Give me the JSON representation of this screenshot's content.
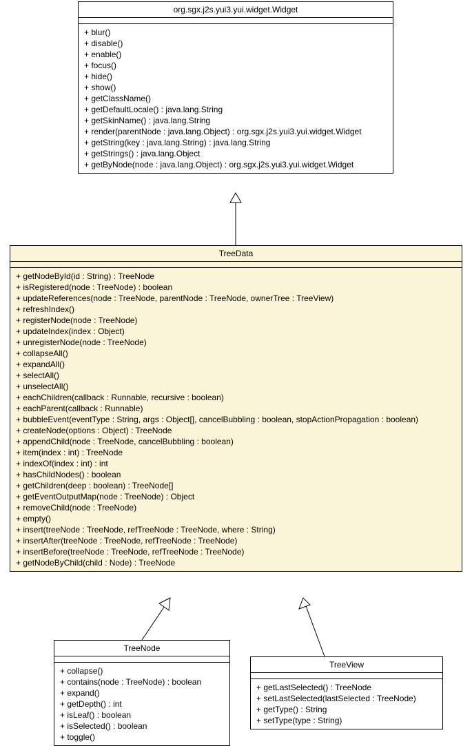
{
  "classes": {
    "widget": {
      "name": "org.sgx.j2s.yui3.yui.widget.Widget",
      "methods": [
        "+ blur()",
        "+ disable()",
        "+ enable()",
        "+ focus()",
        "+ hide()",
        "+ show()",
        "+ getClassName()",
        "+ getDefaultLocale() : java.lang.String",
        "+ getSkinName() : java.lang.String",
        "+ render(parentNode : java.lang.Object) : org.sgx.j2s.yui3.yui.widget.Widget",
        "+ getString(key : java.lang.String) : java.lang.String",
        "+ getStrings() : java.lang.Object",
        "+ getByNode(node : java.lang.Object) : org.sgx.j2s.yui3.yui.widget.Widget"
      ]
    },
    "treedata": {
      "name": "TreeData",
      "methods": [
        "+ getNodeById(id : String) : TreeNode",
        "+ isRegistered(node : TreeNode) : boolean",
        "+ updateReferences(node : TreeNode, parentNode : TreeNode, ownerTree : TreeView)",
        "+ refreshIndex()",
        "+ registerNode(node : TreeNode)",
        "+ updateIndex(index : Object)",
        "+ unregisterNode(node : TreeNode)",
        "+ collapseAll()",
        "+ expandAll()",
        "+ selectAll()",
        "+ unselectAll()",
        "+ eachChildren(callback : Runnable, recursive : boolean)",
        "+ eachParent(callback : Runnable)",
        "+ bubbleEvent(eventType : String, args : Object[], cancelBubbling : boolean, stopActionPropagation : boolean)",
        "+ createNode(options : Object) : TreeNode",
        "+ appendChild(node : TreeNode, cancelBubbling : boolean)",
        "+ item(index : int) : TreeNode",
        "+ indexOf(index : int) : int",
        "+ hasChildNodes() : boolean",
        "+ getChildren(deep : boolean) : TreeNode[]",
        "+ getEventOutputMap(node : TreeNode) : Object",
        "+ removeChild(node : TreeNode)",
        "+ empty()",
        "+ insert(treeNode : TreeNode, refTreeNode : TreeNode, where : String)",
        "+ insertAfter(treeNode : TreeNode, refTreeNode : TreeNode)",
        "+ insertBefore(treeNode : TreeNode, refTreeNode : TreeNode)",
        "+ getNodeByChild(child : Node) : TreeNode"
      ]
    },
    "treenode": {
      "name": "TreeNode",
      "methods": [
        "+ collapse()",
        "+ contains(node : TreeNode) : boolean",
        "+ expand()",
        "+ getDepth() : int",
        "+ isLeaf() : boolean",
        "+ isSelected() : boolean",
        "+ toggle()"
      ]
    },
    "treeview": {
      "name": "TreeView",
      "methods": [
        "+ getLastSelected() : TreeNode",
        "+ setLastSelected(lastSelected : TreeNode)",
        "+ getType() : String",
        "+ setType(type : String)"
      ]
    }
  }
}
